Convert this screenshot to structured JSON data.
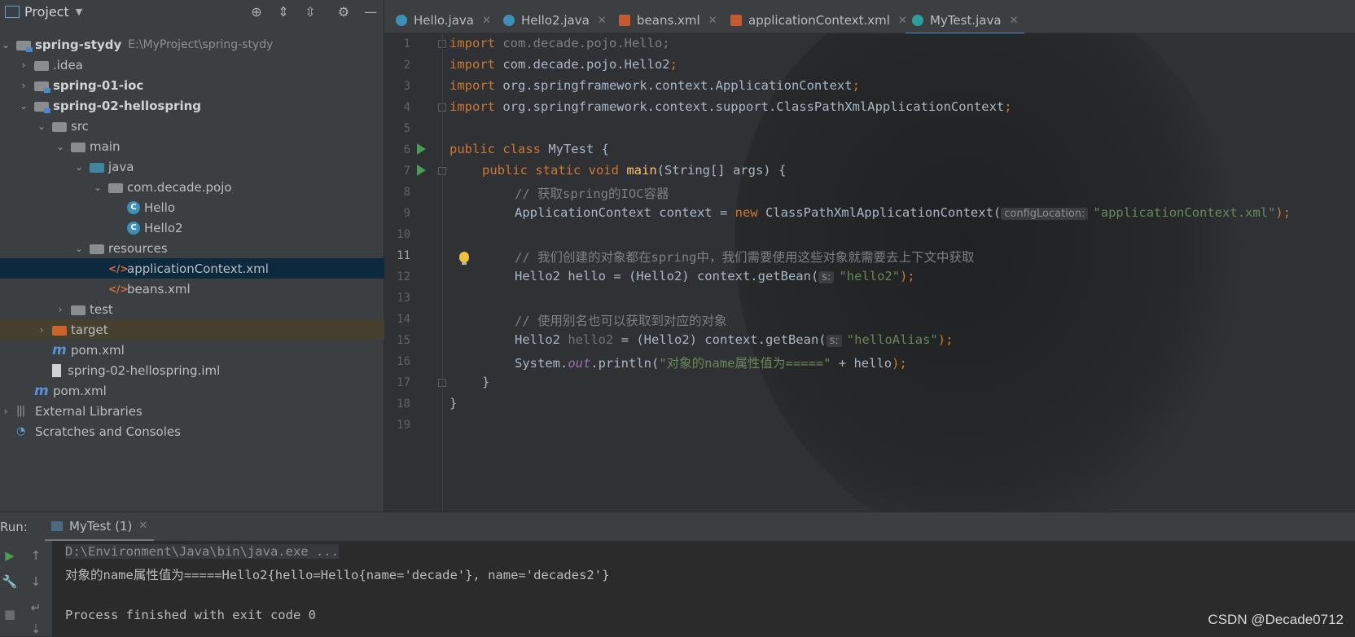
{
  "project_panel": {
    "title": "Project",
    "icons": [
      "locate-icon",
      "expand-all-icon",
      "collapse-all-icon",
      "gear-icon",
      "hide-icon"
    ],
    "tree": [
      {
        "label": "spring-stydy",
        "path": "E:\\MyProject\\spring-stydy",
        "bold": true,
        "expanded": true,
        "icon": "module-folder-icon"
      },
      {
        "label": ".idea",
        "icon": "folder-icon"
      },
      {
        "label": "spring-01-ioc",
        "bold": true,
        "icon": "module-folder-icon"
      },
      {
        "label": "spring-02-hellospring",
        "bold": true,
        "expanded": true,
        "icon": "module-folder-icon"
      },
      {
        "label": "src",
        "expanded": true,
        "icon": "folder-icon"
      },
      {
        "label": "main",
        "expanded": true,
        "icon": "folder-icon"
      },
      {
        "label": "java",
        "expanded": true,
        "icon": "source-folder-icon"
      },
      {
        "label": "com.decade.pojo",
        "expanded": true,
        "icon": "package-icon"
      },
      {
        "label": "Hello",
        "icon": "java-class-icon"
      },
      {
        "label": "Hello2",
        "icon": "java-class-icon"
      },
      {
        "label": "resources",
        "expanded": true,
        "icon": "resources-folder-icon"
      },
      {
        "label": "applicationContext.xml",
        "icon": "spring-xml-icon",
        "selected": true
      },
      {
        "label": "beans.xml",
        "icon": "spring-xml-icon"
      },
      {
        "label": "test",
        "icon": "folder-icon"
      },
      {
        "label": "target",
        "icon": "excluded-folder-icon"
      },
      {
        "label": "pom.xml",
        "icon": "maven-icon"
      },
      {
        "label": "spring-02-hellospring.iml",
        "icon": "iml-file-icon"
      },
      {
        "label": "pom.xml",
        "icon": "maven-icon"
      },
      {
        "label": "External Libraries",
        "icon": "libraries-icon"
      },
      {
        "label": "Scratches and Consoles",
        "icon": "scratches-icon"
      }
    ]
  },
  "editor": {
    "tabs": [
      {
        "label": "Hello.java",
        "icon": "java-class-icon"
      },
      {
        "label": "Hello2.java",
        "icon": "java-class-icon"
      },
      {
        "label": "beans.xml",
        "icon": "spring-xml-icon"
      },
      {
        "label": "applicationContext.xml",
        "icon": "spring-xml-icon"
      },
      {
        "label": "MyTest.java",
        "icon": "java-class-icon",
        "active": true
      }
    ],
    "line_numbers": [
      "1",
      "2",
      "3",
      "4",
      "5",
      "6",
      "7",
      "8",
      "9",
      "10",
      "11",
      "12",
      "13",
      "14",
      "15",
      "16",
      "17",
      "18",
      "19"
    ],
    "current_line": "11",
    "code": {
      "l1_kw": "import",
      "l1_rest": " com.decade.pojo.Hello;",
      "l2_kw": "import",
      "l2_rest": " com.decade.pojo.Hello2",
      "l3_kw": "import",
      "l3_rest": " org.springframework.context.ApplicationContext",
      "l4_kw": "import",
      "l4_rest": " org.springframework.context.support.ClassPathXmlApplicationContext",
      "semi": ";",
      "l6_kw": "public class",
      "l6_rest": " MyTest {",
      "l7_kw": "public static void",
      "l7_fn": "main",
      "l7_rest": "(String[] args) {",
      "l8": "// 获取spring的IOC容器",
      "l9_a": "ApplicationContext context = ",
      "l9_new": "new",
      "l9_b": " ClassPathXmlApplicationContext(",
      "l9_hint": "configLocation:",
      "l9_str": "\"applicationContext.xml\"",
      "l9_end": ");",
      "l11": "// 我们创建的对象都在spring中，我们需要使用这些对象就需要去上下文中获取",
      "l12_a": "Hello2 hello = (Hello2) context.getBean(",
      "l12_hint": "s:",
      "l12_str": "\"hello2\"",
      "l12_end": ");",
      "l14": "// 使用别名也可以获取到对应的对象",
      "l15_a": "Hello2 ",
      "l15_var": "hello2",
      "l15_b": " = (Hello2) context.getBean(",
      "l15_hint": "s:",
      "l15_str": "\"helloAlias\"",
      "l15_end": ");",
      "l16_a": "System.",
      "l16_out": "out",
      "l16_b": ".println(",
      "l16_str": "\"对象的name属性值为=====\"",
      "l16_c": " + hello",
      "l16_end": ");",
      "l17": "}",
      "l18": "}"
    }
  },
  "run_panel": {
    "label": "Run:",
    "tab_label": "MyTest (1)",
    "side_icons": [
      "rerun-icon",
      "up-arrow-icon",
      "wrench-icon",
      "down-arrow-icon",
      "stop-icon",
      "soft-wrap-icon",
      "scroll-to-end-icon"
    ],
    "console": [
      "D:\\Environment\\Java\\bin\\java.exe ...",
      "对象的name属性值为=====Hello2{hello=Hello{name='decade'}, name='decades2'}",
      "",
      "Process finished with exit code 0"
    ]
  },
  "watermark": "CSDN @Decade0712",
  "colors": {
    "keyword": "#cc7832",
    "string": "#6a8759",
    "comment": "#808080",
    "selection": "#0d293e",
    "accent": "#4a88c7",
    "run_green": "#499c54"
  }
}
